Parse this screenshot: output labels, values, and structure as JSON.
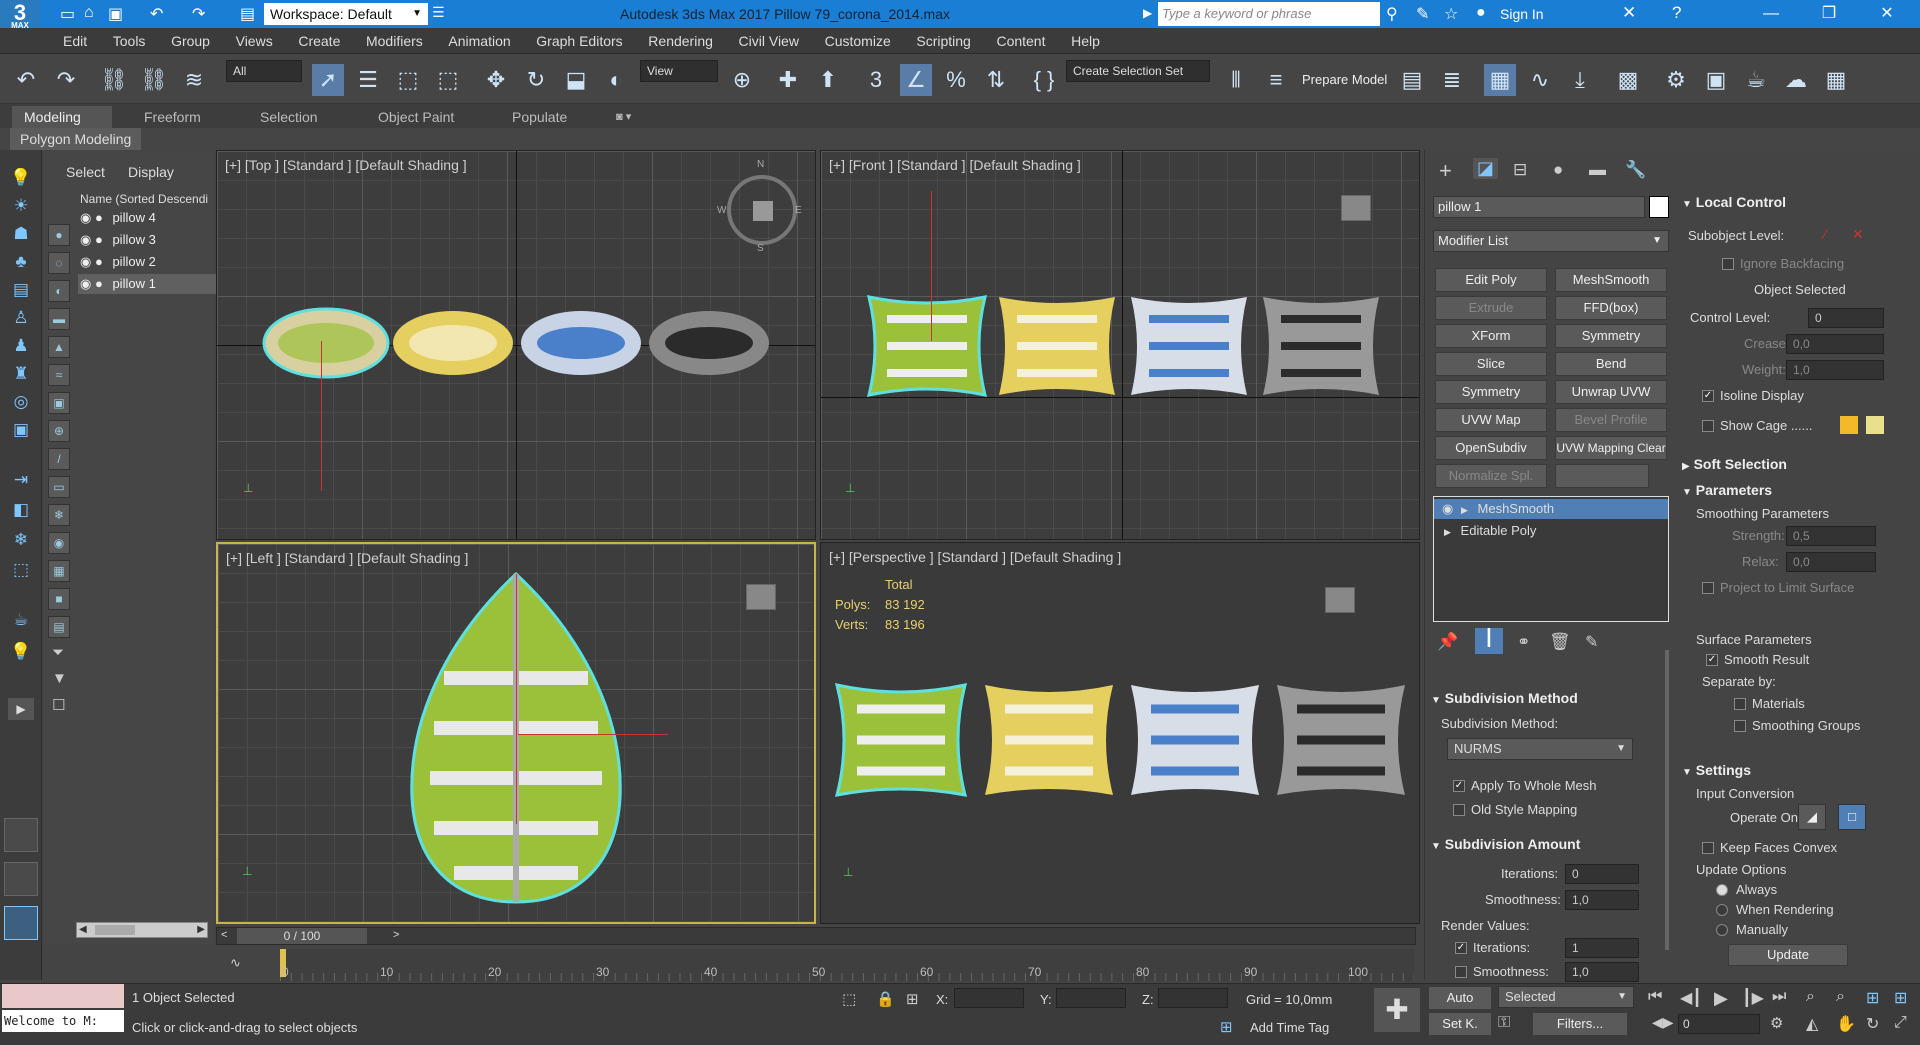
{
  "titlebar": {
    "logo": "3",
    "logo_sub": "MAX",
    "workspace": "Workspace: Default",
    "title": "Autodesk 3ds Max 2017     Pillow 79_corona_2014.max",
    "search_placeholder": "Type a keyword or phrase",
    "signin": "Sign In"
  },
  "menu": [
    "Edit",
    "Tools",
    "Group",
    "Views",
    "Create",
    "Modifiers",
    "Animation",
    "Graph Editors",
    "Rendering",
    "Civil View",
    "Customize",
    "Scripting",
    "Content",
    "Help"
  ],
  "toolbar": {
    "filter": "All",
    "ref_coord": "View",
    "selection_set": "Create Selection Set",
    "prepare_model": "Prepare Model"
  },
  "ribbon": {
    "tabs": [
      "Modeling",
      "Freeform",
      "Selection",
      "Object Paint",
      "Populate"
    ],
    "sub": "Polygon Modeling"
  },
  "explorer": {
    "tabs": [
      "Select",
      "Display"
    ],
    "header": "Name (Sorted Descendi",
    "items": [
      "pillow 4",
      "pillow 3",
      "pillow 2",
      "pillow 1"
    ]
  },
  "viewports": {
    "top": "[+] [Top ] [Standard ] [Default Shading ]",
    "front": "[+] [Front ] [Standard ] [Default Shading ]",
    "left": "[+] [Left ] [Standard ] [Default Shading ]",
    "persp": "[+] [Perspective ] [Standard ] [Default Shading ]",
    "stats_total": "Total",
    "stats_polys_label": "Polys:",
    "stats_polys": "83 192",
    "stats_verts_label": "Verts:",
    "stats_verts": "83 196",
    "compass_n": "N",
    "compass_s": "S",
    "compass_e": "E",
    "compass_w": "W"
  },
  "command_panel": {
    "object_name": "pillow 1",
    "modifier_list": "Modifier List",
    "buttons": [
      "Edit Poly",
      "MeshSmooth",
      "Extrude",
      "FFD(box)",
      "XForm",
      "Symmetry",
      "Slice",
      "Bend",
      "Symmetry",
      "Unwrap UVW",
      "UVW Map",
      "Bevel Profile",
      "OpenSubdiv",
      "UVW Mapping Clear",
      "Normalize Spl."
    ],
    "stack": [
      "MeshSmooth",
      "Editable Poly"
    ],
    "subdiv_method_head": "Subdivision Method",
    "subdiv_method_label": "Subdivision Method:",
    "subdiv_method_value": "NURMS",
    "apply_whole_mesh": "Apply To Whole Mesh",
    "old_style": "Old Style Mapping",
    "subdiv_amount_head": "Subdivision Amount",
    "iterations_label": "Iterations:",
    "iterations": "0",
    "smoothness_label": "Smoothness:",
    "smoothness": "1,0",
    "render_values": "Render Values:",
    "r_iterations_label": "Iterations:",
    "r_iterations": "1",
    "r_smoothness_label": "Smoothness:",
    "r_smoothness": "1,0"
  },
  "rollout": {
    "local_control": "Local Control",
    "subobject_level": "Subobject Level:",
    "ignore_backfacing": "Ignore Backfacing",
    "object_selected": "Object Selected",
    "control_level_label": "Control Level:",
    "control_level": "0",
    "crease_label": "Crease:",
    "crease": "0,0",
    "weight_label": "Weight:",
    "weight": "1,0",
    "isoline": "Isoline Display",
    "show_cage": "Show Cage ......",
    "soft_selection": "Soft Selection",
    "parameters": "Parameters",
    "smoothing_params": "Smoothing Parameters",
    "strength_label": "Strength:",
    "strength": "0,5",
    "relax_label": "Relax:",
    "relax": "0,0",
    "project_limit": "Project to Limit Surface",
    "surface_params": "Surface Parameters",
    "smooth_result": "Smooth Result",
    "separate_by": "Separate by:",
    "materials": "Materials",
    "smoothing_groups": "Smoothing Groups",
    "settings": "Settings",
    "input_conversion": "Input Conversion",
    "operate_on": "Operate On:",
    "keep_convex": "Keep Faces Convex",
    "update_options": "Update Options",
    "always": "Always",
    "when_rendering": "When Rendering",
    "manually": "Manually",
    "update": "Update"
  },
  "timeline": {
    "frame": "0 / 100",
    "ticks": [
      "0",
      "10",
      "20",
      "30",
      "40",
      "50",
      "60",
      "70",
      "80",
      "90",
      "100"
    ]
  },
  "status": {
    "maxscript": "Welcome to M:",
    "selected": "1 Object Selected",
    "prompt": "Click or click-and-drag to select objects",
    "x_label": "X:",
    "y_label": "Y:",
    "z_label": "Z:",
    "grid": "Grid = 10,0mm",
    "add_time_tag": "Add Time Tag",
    "auto": "Auto",
    "set_key": "Set K.",
    "selected_dd": "Selected",
    "filters": "Filters...",
    "frame_field": "0"
  },
  "colors": {
    "accent": "#1a7fd4",
    "selection": "#5ee0e0",
    "viewport_active": "#c8b44a",
    "green": "#9bc13b",
    "yellow": "#e5cf5f",
    "blue": "#4a7fc9",
    "black": "#2b2b2b"
  }
}
